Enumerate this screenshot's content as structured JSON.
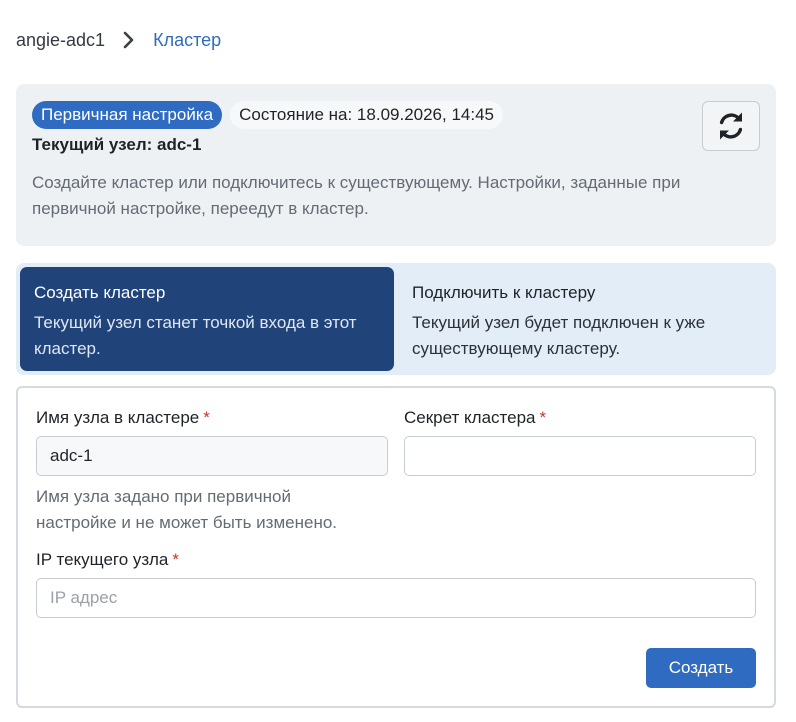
{
  "breadcrumb": {
    "root": "angie-adc1",
    "current": "Кластер"
  },
  "status_panel": {
    "badge": "Первичная настройка",
    "state": "Состояние на: 18.09.2026, 14:45",
    "current_node": "Текущий узел: adc-1",
    "description": "Создайте кластер или подключитесь к существующему. Настройки, заданные при первичной настройке, переедут в кластер."
  },
  "modes": {
    "create": {
      "title": "Создать кластер",
      "subtitle": "Текущий узел станет точкой входа в этот кластер."
    },
    "join": {
      "title": "Подключить к кластеру",
      "subtitle": "Текущий узел будет подключен к уже существующему кластеру."
    }
  },
  "form": {
    "node_name": {
      "label": "Имя узла в кластере",
      "value": "adc-1",
      "hint": "Имя узла задано при первичной настройке и не может быть изменено."
    },
    "secret": {
      "label": "Секрет кластера",
      "value": ""
    },
    "ip": {
      "label": "IP текущего узла",
      "placeholder": "IP адрес",
      "value": ""
    },
    "required_mark": "*",
    "submit_label": "Создать"
  },
  "colors": {
    "accent": "#2f6bc0",
    "selected_mode": "#20437a",
    "required": "#c0392b"
  },
  "icons": {
    "breadcrumb_separator": "chevron-right-icon",
    "refresh": "refresh-icon"
  }
}
